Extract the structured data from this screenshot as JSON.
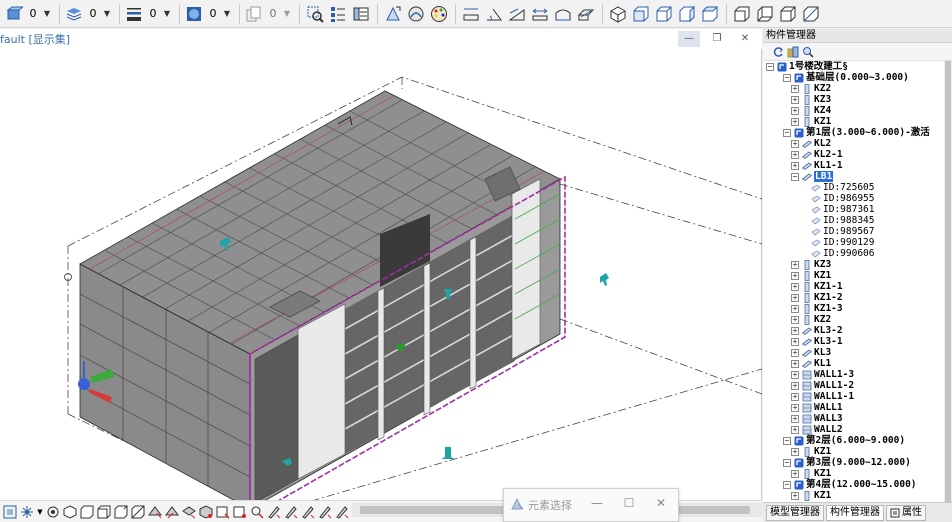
{
  "toolbar": {
    "layer_combos": [
      {
        "name": "layer-combo-1",
        "value": "0"
      },
      {
        "name": "layer-combo-2",
        "value": "0"
      },
      {
        "name": "layer-combo-3",
        "value": "0"
      },
      {
        "name": "layer-combo-4",
        "value": "0"
      },
      {
        "name": "layer-combo-5",
        "value": "0"
      }
    ]
  },
  "viewport": {
    "title": "fault [显示集]",
    "minimize": "—",
    "restore": "❐",
    "close": "✕"
  },
  "floating_dialog": {
    "title": "元素选择",
    "minimize": "—",
    "maximize": "☐",
    "close": "✕"
  },
  "panel": {
    "title": "构件管理器",
    "tree": [
      {
        "level": 0,
        "exp": "−",
        "type": "project",
        "label": "1号楼改建工§"
      },
      {
        "level": 1,
        "exp": "−",
        "type": "floor",
        "label": "基础层(0.000~3.000)"
      },
      {
        "level": 2,
        "exp": "+",
        "type": "col",
        "label": "KZ2"
      },
      {
        "level": 2,
        "exp": "+",
        "type": "col",
        "label": "KZ3"
      },
      {
        "level": 2,
        "exp": "+",
        "type": "col",
        "label": "KZ4"
      },
      {
        "level": 2,
        "exp": "+",
        "type": "col",
        "label": "KZ1"
      },
      {
        "level": 1,
        "exp": "−",
        "type": "floor",
        "label": "第1层(3.000~6.000)-激活"
      },
      {
        "level": 2,
        "exp": "+",
        "type": "beam",
        "label": "KL2"
      },
      {
        "level": 2,
        "exp": "+",
        "type": "beam",
        "label": "KL2-1"
      },
      {
        "level": 2,
        "exp": "+",
        "type": "beam",
        "label": "KL1-1"
      },
      {
        "level": 2,
        "exp": "−",
        "type": "beam",
        "label": "LB1",
        "selected": true
      },
      {
        "level": 3,
        "exp": "",
        "type": "id",
        "label": "ID:725605"
      },
      {
        "level": 3,
        "exp": "",
        "type": "id",
        "label": "ID:986955"
      },
      {
        "level": 3,
        "exp": "",
        "type": "id",
        "label": "ID:987361"
      },
      {
        "level": 3,
        "exp": "",
        "type": "id",
        "label": "ID:988345"
      },
      {
        "level": 3,
        "exp": "",
        "type": "id",
        "label": "ID:989567"
      },
      {
        "level": 3,
        "exp": "",
        "type": "id",
        "label": "ID:990129"
      },
      {
        "level": 3,
        "exp": "",
        "type": "id",
        "label": "ID:990606"
      },
      {
        "level": 2,
        "exp": "+",
        "type": "col",
        "label": "KZ3"
      },
      {
        "level": 2,
        "exp": "+",
        "type": "col",
        "label": "KZ1"
      },
      {
        "level": 2,
        "exp": "+",
        "type": "col",
        "label": "KZ1-1"
      },
      {
        "level": 2,
        "exp": "+",
        "type": "col",
        "label": "KZ1-2"
      },
      {
        "level": 2,
        "exp": "+",
        "type": "col",
        "label": "KZ1-3"
      },
      {
        "level": 2,
        "exp": "+",
        "type": "col",
        "label": "KZ2"
      },
      {
        "level": 2,
        "exp": "+",
        "type": "beam",
        "label": "KL3-2"
      },
      {
        "level": 2,
        "exp": "+",
        "type": "beam",
        "label": "KL3-1"
      },
      {
        "level": 2,
        "exp": "+",
        "type": "beam",
        "label": "KL3"
      },
      {
        "level": 2,
        "exp": "+",
        "type": "beam",
        "label": "KL1"
      },
      {
        "level": 2,
        "exp": "+",
        "type": "wall",
        "label": "WALL1-3"
      },
      {
        "level": 2,
        "exp": "+",
        "type": "wall",
        "label": "WALL1-2"
      },
      {
        "level": 2,
        "exp": "+",
        "type": "wall",
        "label": "WALL1-1"
      },
      {
        "level": 2,
        "exp": "+",
        "type": "wall",
        "label": "WALL1"
      },
      {
        "level": 2,
        "exp": "+",
        "type": "wall",
        "label": "WALL3"
      },
      {
        "level": 2,
        "exp": "+",
        "type": "wall",
        "label": "WALL2"
      },
      {
        "level": 1,
        "exp": "−",
        "type": "floor",
        "label": "第2层(6.000~9.000)"
      },
      {
        "level": 2,
        "exp": "+",
        "type": "col",
        "label": "KZ1"
      },
      {
        "level": 1,
        "exp": "−",
        "type": "floor",
        "label": "第3层(9.000~12.000)"
      },
      {
        "level": 2,
        "exp": "+",
        "type": "col",
        "label": "KZ1"
      },
      {
        "level": 1,
        "exp": "−",
        "type": "floor",
        "label": "第4层(12.000~15.000)"
      },
      {
        "level": 2,
        "exp": "+",
        "type": "col",
        "label": "KZ1"
      }
    ],
    "tabs": [
      {
        "label": "模型管理器",
        "active": false
      },
      {
        "label": "构件管理器",
        "active": true
      },
      {
        "label": "属性",
        "active": false
      }
    ]
  },
  "colors": {
    "accent": "#2a6fd6",
    "selection_box": "#a030a0",
    "model_gray": "#8c8c8c"
  }
}
